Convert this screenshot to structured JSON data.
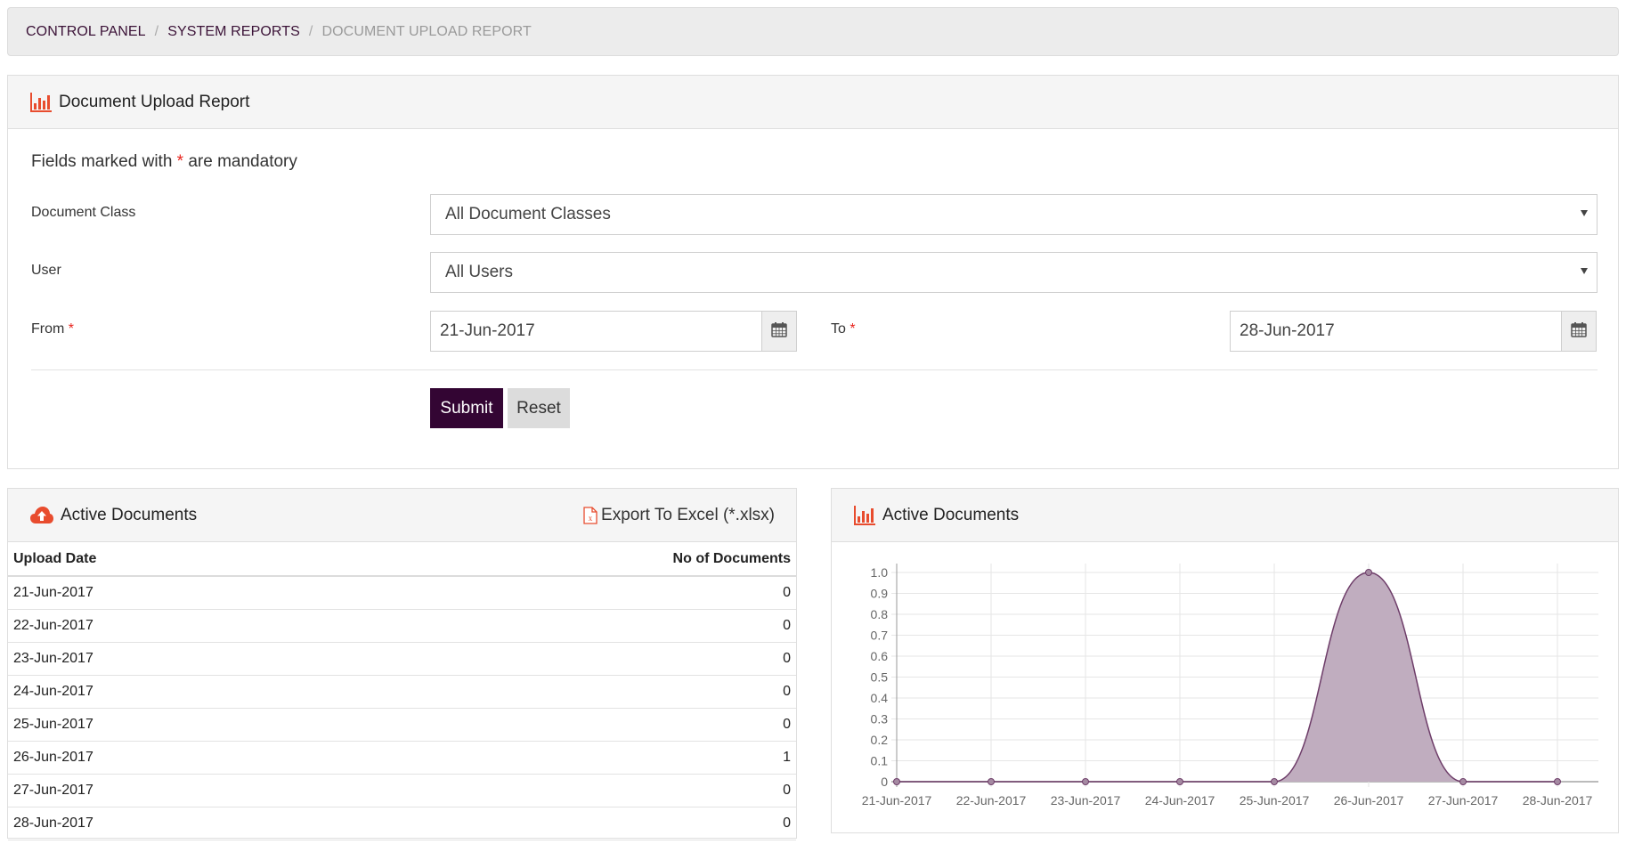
{
  "breadcrumb": {
    "items": [
      "CONTROL PANEL",
      "SYSTEM REPORTS"
    ],
    "separator": "/",
    "current": "DOCUMENT UPLOAD REPORT"
  },
  "report_panel": {
    "title": "Document Upload Report",
    "title_icon": "bar-chart-icon",
    "mandatory_note_prefix": "Fields marked with",
    "mandatory_marker": "*",
    "mandatory_note_suffix": "are mandatory",
    "fields": {
      "document_class": {
        "label": "Document Class",
        "value": "All Document Classes"
      },
      "user": {
        "label": "User",
        "value": "All Users"
      },
      "from": {
        "label": "From",
        "required_marker": "*",
        "value": "21-Jun-2017",
        "icon": "calendar-icon"
      },
      "to": {
        "label": "To",
        "required_marker": "*",
        "value": "28-Jun-2017",
        "icon": "calendar-icon"
      }
    },
    "buttons": {
      "submit": "Submit",
      "reset": "Reset"
    }
  },
  "table_panel": {
    "title": "Active Documents",
    "title_icon": "cloud-upload-icon",
    "export_label": "Export To Excel (*.xlsx)",
    "export_icon": "excel-file-icon",
    "columns": [
      "Upload Date",
      "No of Documents"
    ],
    "rows": [
      {
        "date": "21-Jun-2017",
        "count": "0"
      },
      {
        "date": "22-Jun-2017",
        "count": "0"
      },
      {
        "date": "23-Jun-2017",
        "count": "0"
      },
      {
        "date": "24-Jun-2017",
        "count": "0"
      },
      {
        "date": "25-Jun-2017",
        "count": "0"
      },
      {
        "date": "26-Jun-2017",
        "count": "1"
      },
      {
        "date": "27-Jun-2017",
        "count": "0"
      },
      {
        "date": "28-Jun-2017",
        "count": "0"
      }
    ]
  },
  "chart_panel": {
    "title": "Active Documents",
    "title_icon": "bar-chart-icon"
  },
  "colors": {
    "accent_icon": "#e84c2e",
    "submit_bg": "#330533",
    "series_line": "#6e3d69",
    "series_fill": "#c0adbf",
    "breadcrumb_link": "#3b1237"
  },
  "chart_data": {
    "type": "area",
    "title": "Active Documents",
    "xlabel": "",
    "ylabel": "",
    "categories": [
      "21-Jun-2017",
      "22-Jun-2017",
      "23-Jun-2017",
      "24-Jun-2017",
      "25-Jun-2017",
      "26-Jun-2017",
      "27-Jun-2017",
      "28-Jun-2017"
    ],
    "series": [
      {
        "name": "Active Documents",
        "values": [
          0,
          0,
          0,
          0,
          0,
          1,
          0,
          0
        ]
      }
    ],
    "ylim": [
      0,
      1.0
    ],
    "yticks": [
      "0",
      "0.1",
      "0.2",
      "0.3",
      "0.4",
      "0.5",
      "0.6",
      "0.7",
      "0.8",
      "0.9",
      "1.0"
    ],
    "grid": true,
    "legend": "none",
    "smoothed": true
  }
}
